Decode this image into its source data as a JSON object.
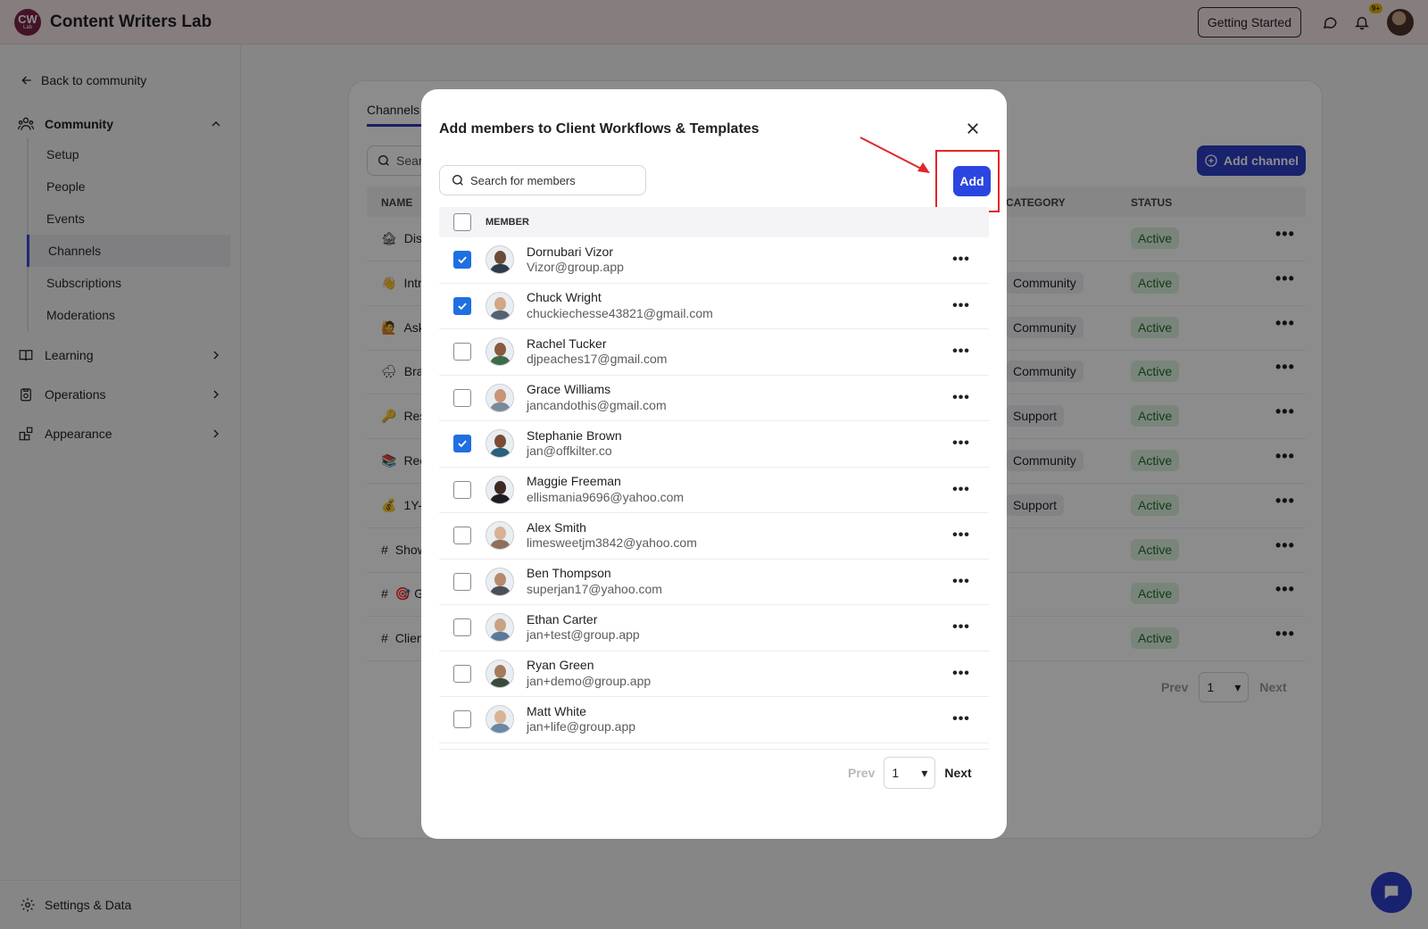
{
  "app": {
    "logo_text": "CW",
    "logo_subtext": "Lab",
    "title": "Content Writers Lab",
    "getting_started": "Getting Started",
    "notification_badge": "9+"
  },
  "sidebar": {
    "back_label": "Back to community",
    "community_label": "Community",
    "sub_items": [
      "Setup",
      "People",
      "Events",
      "Channels",
      "Subscriptions",
      "Moderations"
    ],
    "active_item": "Channels",
    "learning_label": "Learning",
    "operations_label": "Operations",
    "appearance_label": "Appearance",
    "settings_label": "Settings & Data"
  },
  "background": {
    "tab_label": "Channels",
    "search_placeholder": "Search",
    "add_channel_label": "Add channel",
    "columns": {
      "name": "NAME",
      "category": "CATEGORY",
      "status": "STATUS"
    },
    "rows": [
      {
        "icon": "🏚",
        "name": "Discussions",
        "category": "",
        "status": "Active"
      },
      {
        "icon": "👋",
        "name": "Introductions",
        "category": "Community",
        "status": "Active"
      },
      {
        "icon": "🙋",
        "name": "Ask",
        "category": "Community",
        "status": "Active"
      },
      {
        "icon": "🌧",
        "name": "Brainstorm",
        "category": "Community",
        "status": "Active"
      },
      {
        "icon": "🔑",
        "name": "Resources",
        "category": "Support",
        "status": "Active"
      },
      {
        "icon": "📚",
        "name": "Recommended",
        "category": "Community",
        "status": "Active"
      },
      {
        "icon": "💰",
        "name": "1Y-1",
        "category": "Support",
        "status": "Active"
      },
      {
        "icon": "#",
        "name": "Showcase",
        "category": "",
        "status": "Active"
      },
      {
        "icon": "#",
        "name": "🎯 Goals",
        "category": "",
        "status": "Active"
      },
      {
        "icon": "#",
        "name": "Client Workflows & Templates",
        "category": "",
        "status": "Active"
      }
    ],
    "pager": {
      "prev": "Prev",
      "page": "1",
      "next": "Next"
    }
  },
  "modal": {
    "title": "Add members to Client Workflows & Templates",
    "search_placeholder": "Search for members",
    "add_label": "Add",
    "member_column": "MEMBER",
    "members": [
      {
        "name": "Dornubari Vizor",
        "email": "Vizor@group.app",
        "checked": true
      },
      {
        "name": "Chuck Wright",
        "email": "chuckiechesse43821@gmail.com",
        "checked": true
      },
      {
        "name": "Rachel Tucker",
        "email": "djpeaches17@gmail.com",
        "checked": false
      },
      {
        "name": "Grace Williams",
        "email": "jancandothis@gmail.com",
        "checked": false
      },
      {
        "name": "Stephanie Brown",
        "email": "jan@offkilter.co",
        "checked": true
      },
      {
        "name": "Maggie Freeman",
        "email": "ellismania9696@yahoo.com",
        "checked": false
      },
      {
        "name": "Alex Smith",
        "email": "limesweetjm3842@yahoo.com",
        "checked": false
      },
      {
        "name": "Ben Thompson",
        "email": "superjan17@yahoo.com",
        "checked": false
      },
      {
        "name": "Ethan Carter",
        "email": "jan+test@group.app",
        "checked": false
      },
      {
        "name": "Ryan Green",
        "email": "jan+demo@group.app",
        "checked": false
      },
      {
        "name": "Matt White",
        "email": "jan+life@group.app",
        "checked": false
      }
    ],
    "pager": {
      "prev": "Prev",
      "page": "1",
      "next": "Next"
    }
  },
  "colors": {
    "primary": "#2b45e0",
    "checkbox_checked": "#1e6fe0",
    "highlight": "#e0262b",
    "topbar": "#f3e3e6",
    "status_active_bg": "#ddf3de"
  }
}
